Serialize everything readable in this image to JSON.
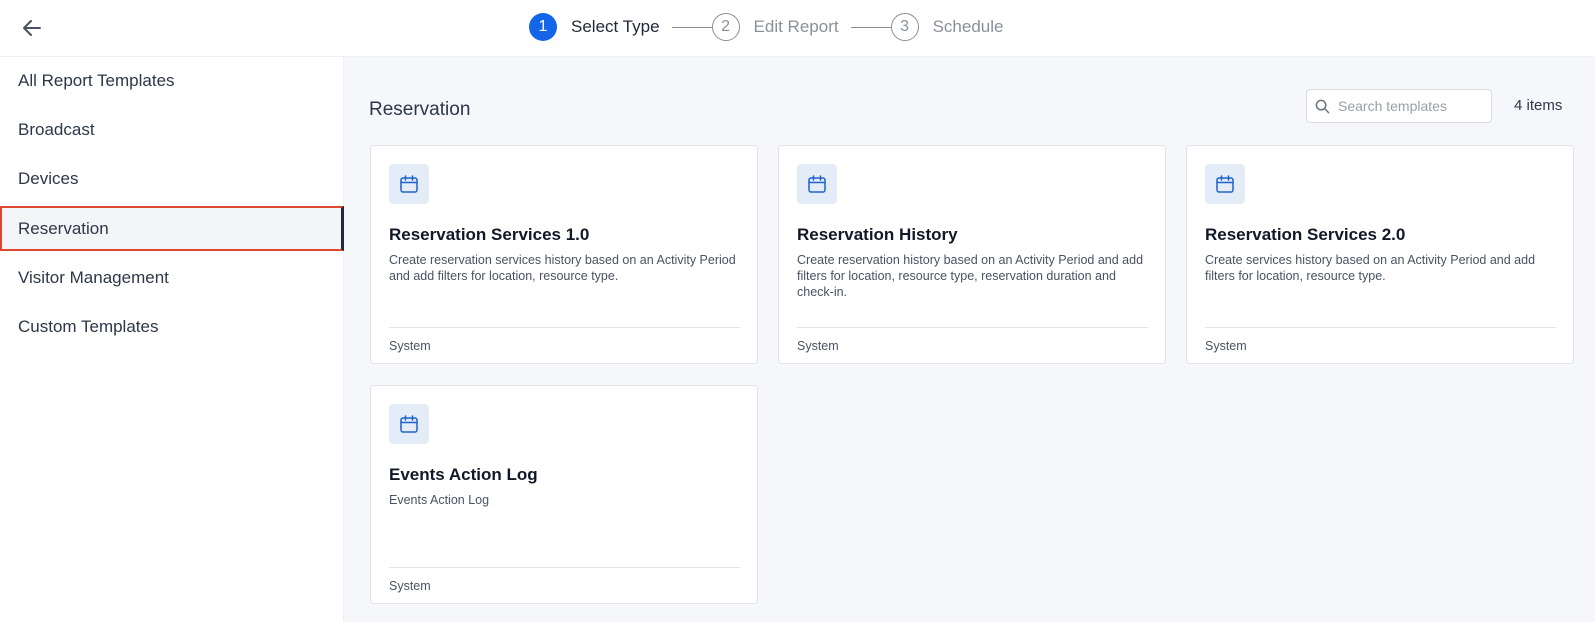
{
  "header": {
    "steps": [
      {
        "number": "1",
        "label": "Select Type",
        "state": "active"
      },
      {
        "number": "2",
        "label": "Edit Report",
        "state": "inactive"
      },
      {
        "number": "3",
        "label": "Schedule",
        "state": "inactive"
      }
    ]
  },
  "sidebar": {
    "items": [
      {
        "label": "All Report Templates"
      },
      {
        "label": "Broadcast"
      },
      {
        "label": "Devices"
      },
      {
        "label": "Reservation",
        "selected": true
      },
      {
        "label": "Visitor Management"
      },
      {
        "label": "Custom Templates"
      }
    ]
  },
  "main": {
    "title": "Reservation",
    "search": {
      "placeholder": "Search templates",
      "value": ""
    },
    "count": "4 items",
    "cards": [
      {
        "icon": "calendar-icon",
        "title": "Reservation Services 1.0",
        "description": "Create reservation services history based on an Activity Period and add filters for location, resource type.",
        "footer": "System"
      },
      {
        "icon": "calendar-icon",
        "title": "Reservation History",
        "description": "Create reservation history based on an Activity Period and add filters for location, resource type, reservation duration and check-in.",
        "footer": "System"
      },
      {
        "icon": "calendar-icon",
        "title": "Reservation Services 2.0",
        "description": "Create services history based on an Activity Period and add filters for location, resource type.",
        "footer": "System"
      },
      {
        "icon": "calendar-icon",
        "title": "Events Action Log",
        "description": "Events Action Log",
        "footer": "System"
      }
    ]
  },
  "colors": {
    "accent": "#1565e8",
    "selection_outline": "#e0472f",
    "icon_bg": "#e4ecf7"
  }
}
